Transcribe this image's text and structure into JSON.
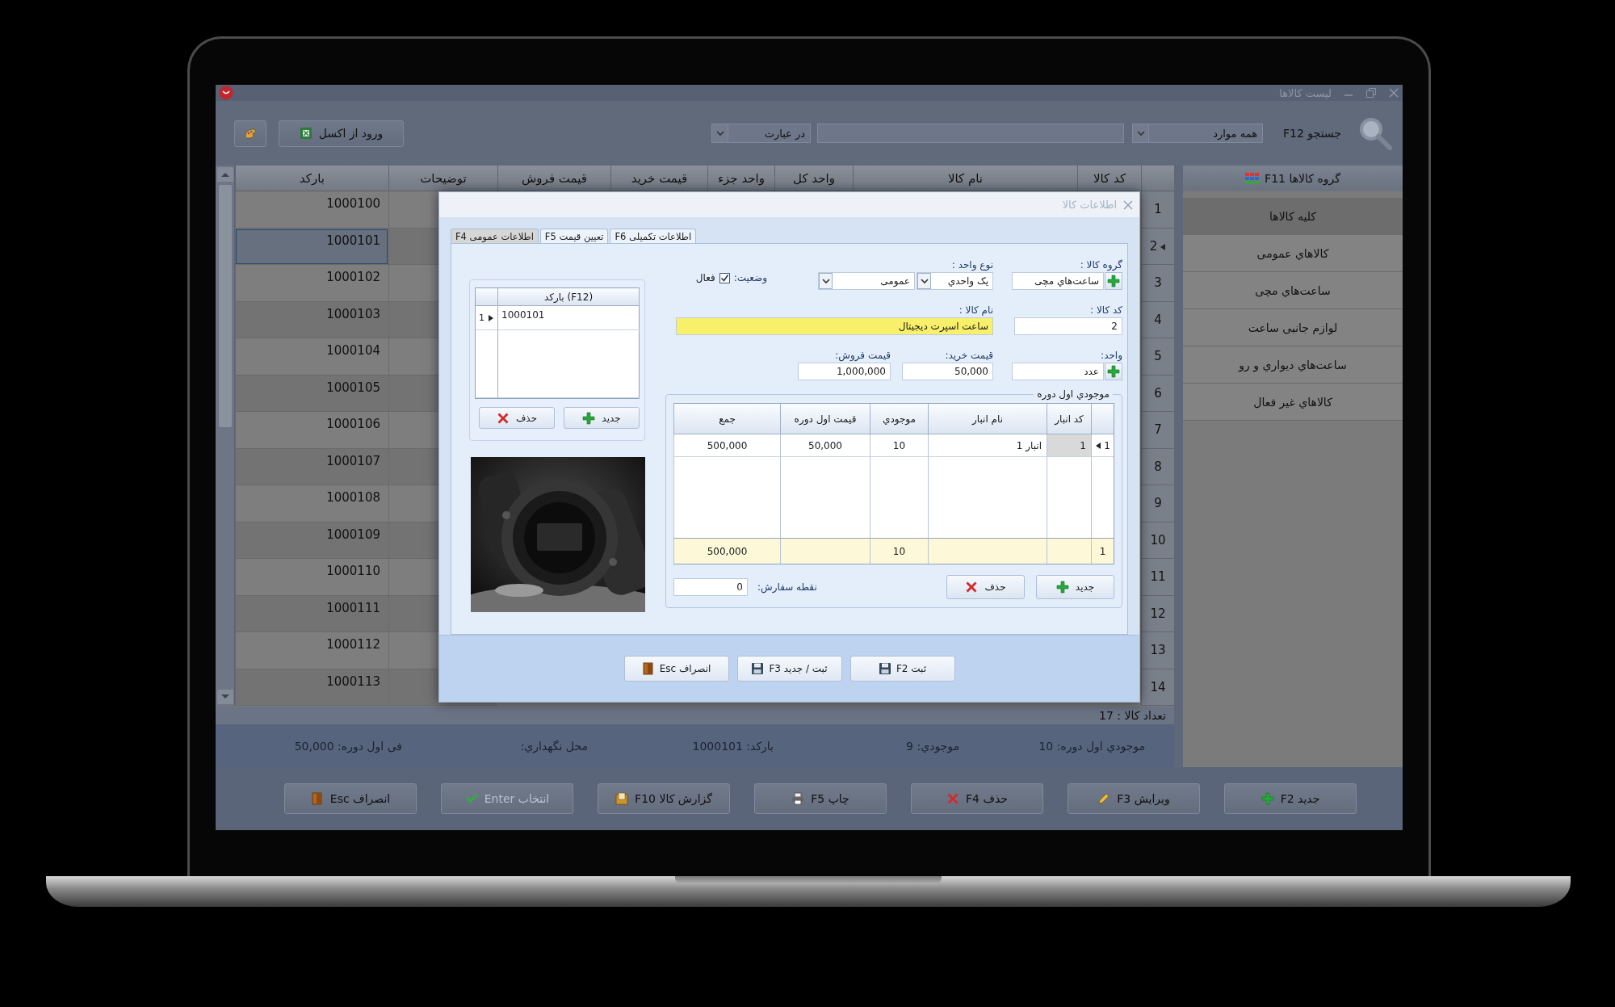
{
  "window": {
    "title": "لیست کالاها"
  },
  "toolbar": {
    "search_label": "جستجو F12",
    "filter": "همه موارد",
    "match_mode": "در عبارت",
    "import_button": "ورود از اکسل"
  },
  "sidebar": {
    "title": "گروه کالاها F11",
    "items": [
      {
        "label": "کلیه کالاها",
        "selected": true
      },
      {
        "label": "کالاهاي عمومی",
        "selected": false
      },
      {
        "label": "ساعت‌هاي مچی",
        "selected": false
      },
      {
        "label": "لوازم جانبی ساعت",
        "selected": false
      },
      {
        "label": "ساعت‌هاي دیواري و رو",
        "selected": false
      },
      {
        "label": "کالاهاي غیر فعال",
        "selected": false
      }
    ]
  },
  "table": {
    "columns": [
      "کد کالا",
      "نام کالا",
      "واحد کل",
      "واحد جزء",
      "قیمت خرید",
      "قیمت فروش",
      "توضیحات",
      "بارکد"
    ],
    "rows": [
      {
        "number": "1",
        "barcode": "1000100",
        "selected": false
      },
      {
        "number": "2",
        "barcode": "1000101",
        "selected": true
      },
      {
        "number": "3",
        "barcode": "1000102",
        "selected": false
      },
      {
        "number": "4",
        "barcode": "1000103",
        "selected": false
      },
      {
        "number": "5",
        "barcode": "1000104",
        "selected": false
      },
      {
        "number": "6",
        "barcode": "1000105",
        "selected": false
      },
      {
        "number": "7",
        "barcode": "1000106",
        "selected": false
      },
      {
        "number": "8",
        "barcode": "1000107",
        "selected": false
      },
      {
        "number": "9",
        "barcode": "1000108",
        "selected": false
      },
      {
        "number": "10",
        "barcode": "1000109",
        "selected": false
      },
      {
        "number": "11",
        "barcode": "1000110",
        "selected": false
      },
      {
        "number": "12",
        "barcode": "1000111",
        "selected": false
      },
      {
        "number": "13",
        "barcode": "1000112",
        "selected": false
      },
      {
        "number": "14",
        "barcode": "1000113",
        "selected": false
      }
    ]
  },
  "status": {
    "count": "تعداد کالا : 17"
  },
  "info_bar": [
    "موجودي اول دوره: 10",
    "موجودي: 9",
    "بارکد: 1000101",
    "محل نگهداري:",
    "فی اول دوره: 50,000"
  ],
  "buttons": [
    {
      "label": "جدید F2",
      "kind": "add",
      "disabled": false
    },
    {
      "label": "ویرایش F3",
      "kind": "edit",
      "disabled": false
    },
    {
      "label": "حذف F4",
      "kind": "delete",
      "disabled": false
    },
    {
      "label": "چاپ F5",
      "kind": "print",
      "disabled": false
    },
    {
      "label": "گزارش کالا F10",
      "kind": "report",
      "disabled": false
    },
    {
      "label": "انتخاب Enter",
      "kind": "select",
      "disabled": true
    },
    {
      "label": "انصراف Esc",
      "kind": "cancel",
      "disabled": false
    }
  ],
  "dialog": {
    "title": "اطلاعات کالا",
    "tabs": [
      {
        "label": "اطلاعات تکمیلی F6",
        "selected": false
      },
      {
        "label": "تعیین قیمت F5",
        "selected": false
      },
      {
        "label": "اطلاعات عمومی F4",
        "selected": true
      }
    ],
    "form": {
      "group": {
        "label": "گروه کالا :",
        "value": "ساعت‌هاي مچی"
      },
      "unit_type": {
        "label": "نوع واحد :",
        "value": "یک واحدي",
        "category": "عمومی"
      },
      "status": {
        "label": "وضعیت:",
        "option": "فعال",
        "checked": true
      },
      "code": {
        "label": "کد کالا :",
        "value": "2"
      },
      "name": {
        "label": "نام کالا :",
        "value": "ساعت اسپرت دیجیتال"
      },
      "unit": {
        "label": "واحد:",
        "value": "عدد"
      },
      "purchase_price": {
        "label": "قیمت خرید:",
        "value": "50,000"
      },
      "sale_price": {
        "label": "قیمت فروش:",
        "value": "1,000,000"
      }
    },
    "barcodes": {
      "column": "بارکد (F12)",
      "rows": [
        {
          "number": "1",
          "value": "1000101",
          "selected": true
        }
      ],
      "buttons": [
        {
          "label": "جدید",
          "kind": "add"
        },
        {
          "label": "حذف",
          "kind": "delete"
        }
      ]
    },
    "stock": {
      "title": "موجودي اول دوره",
      "columns": [
        "کد انبار",
        "نام انبار",
        "موجودي",
        "قیمت اول دوره",
        "جمع"
      ],
      "rows": [
        {
          "number": "1",
          "cells": [
            "1",
            "انبار 1",
            "10",
            "50,000",
            "500,000"
          ],
          "selected": true
        }
      ],
      "totals": {
        "number": "1",
        "quantity": "10",
        "total": "500,000"
      },
      "buttons": [
        {
          "label": "جدید",
          "kind": "add"
        },
        {
          "label": "حذف",
          "kind": "delete"
        }
      ],
      "reorder": {
        "label": "نقطه سفارش:",
        "value": "0"
      }
    },
    "buttons": [
      {
        "label": "ثبت F2",
        "kind": "save"
      },
      {
        "label": "ثبت / جدید F3",
        "kind": "save_new"
      },
      {
        "label": "انصراف Esc",
        "kind": "cancel"
      }
    ]
  }
}
